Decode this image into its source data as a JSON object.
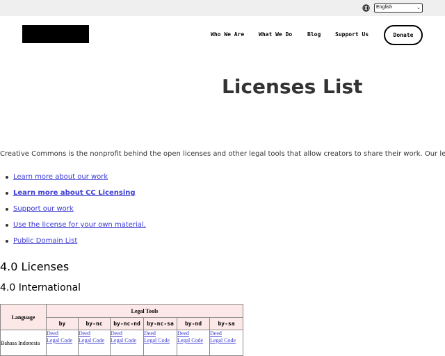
{
  "header": {
    "language_select": "English",
    "nav": [
      "Who We Are",
      "What We Do",
      "Blog",
      "Support Us"
    ],
    "donate": "Donate"
  },
  "page": {
    "title": "Licenses List",
    "intro": "Creative Commons is the nonprofit behind the open licenses and other legal tools that allow creators to share their work. Our legal tools are free",
    "links": [
      {
        "label": "Learn more about our work",
        "bold": false
      },
      {
        "label": "Learn more about CC Licensing",
        "bold": true
      },
      {
        "label": "Support our work",
        "bold": false
      },
      {
        "label": "Use the license for your own material.",
        "bold": false
      },
      {
        "label": "Public Domain List",
        "bold": false
      }
    ],
    "section_heading": "4.0 Licenses",
    "subsection_heading": "4.0 International"
  },
  "table": {
    "language_header": "Language",
    "tools_header": "Legal Tools",
    "codes": [
      "by",
      "by-nc",
      "by-nc-nd",
      "by-nc-sa",
      "by-nd",
      "by-sa"
    ],
    "rows": [
      {
        "language": "Bahasa Indonesia",
        "deed": "Deed",
        "legal_code": "Legal Code"
      }
    ]
  },
  "colors": {
    "link": "#3b3ad6",
    "table_header_bg": "#fde8e8",
    "topbar_bg": "#efefef"
  }
}
